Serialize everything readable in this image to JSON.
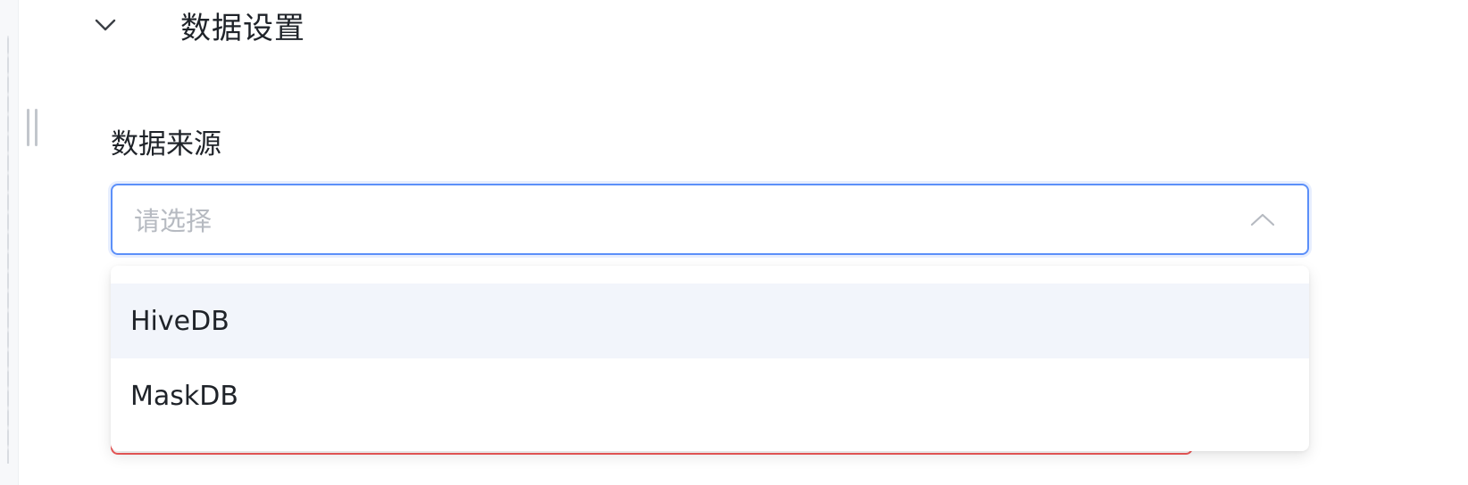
{
  "section": {
    "title": "数据设置",
    "expanded": true,
    "icon": "chevron-down-icon"
  },
  "field": {
    "label": "数据来源",
    "placeholder": "请选择",
    "arrow_icon": "chevron-up-icon",
    "options": [
      {
        "label": "HiveDB",
        "hovered": true
      },
      {
        "label": "MaskDB",
        "hovered": false
      }
    ]
  },
  "colors": {
    "focus_border": "#5b8ff9",
    "error_border": "#f15a5a",
    "option_hover": "#f2f5fb"
  }
}
